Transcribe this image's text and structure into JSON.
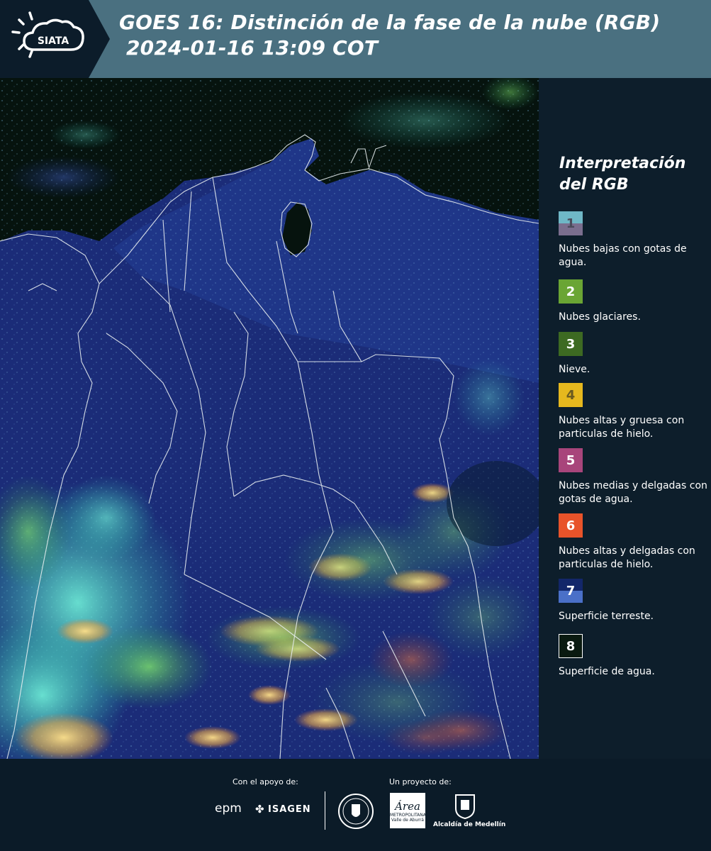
{
  "header": {
    "logo_text": "SIATA",
    "title_line1": "GOES 16: Distinción de la fase de la nube (RGB)",
    "title_line2": "2024-01-16 13:09 COT"
  },
  "legend": {
    "title": "Interpretación del RGB",
    "items": [
      {
        "number": "1",
        "label": "Nubes bajas con gotas de agua.",
        "color_top": "#6fb7c6",
        "color_bottom": "#7a6e8e"
      },
      {
        "number": "2",
        "label": "Nubes glaciares.",
        "color": "#6aa534"
      },
      {
        "number": "3",
        "label": "Nieve.",
        "color": "#3d6a22"
      },
      {
        "number": "4",
        "label": "Nubes altas y gruesa con particulas de hielo.",
        "color": "#e6b81e"
      },
      {
        "number": "5",
        "label": "Nubes medias y delgadas con gotas de agua.",
        "color": "#a8457b"
      },
      {
        "number": "6",
        "label": "Nubes altas y delgadas con particulas de hielo.",
        "color": "#e8532a"
      },
      {
        "number": "7",
        "label": "Superficie terreste.",
        "color_top": "#13276a",
        "color_bottom": "#4a70c8"
      },
      {
        "number": "8",
        "label": "Superficie de agua.",
        "color": "#0a1a10"
      }
    ]
  },
  "footer": {
    "support_label": "Con el apoyo de:",
    "project_label": "Un proyecto de:",
    "sponsor1": "epm",
    "sponsor2": "ISAGEN",
    "area_logo": "Área",
    "area_sub1": "METROPOLITANA",
    "area_sub2": "Valle de Aburrá",
    "alcaldia": "Alcaldía de Medellín"
  }
}
